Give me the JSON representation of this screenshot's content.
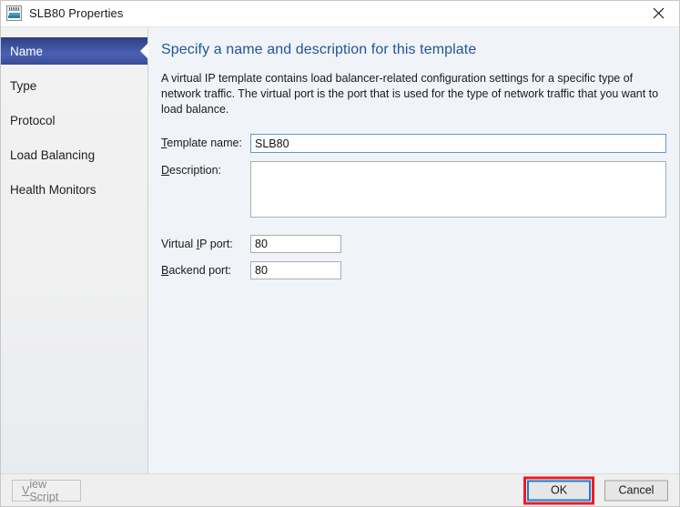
{
  "window": {
    "title": "SLB80 Properties",
    "icon": "template-window-icon",
    "close_label": "✕"
  },
  "sidebar": {
    "items": [
      {
        "label": "Name",
        "selected": true
      },
      {
        "label": "Type",
        "selected": false
      },
      {
        "label": "Protocol",
        "selected": false
      },
      {
        "label": "Load Balancing",
        "selected": false
      },
      {
        "label": "Health Monitors",
        "selected": false
      }
    ]
  },
  "content": {
    "heading": "Specify a name and description for this template",
    "description": "A virtual IP template contains load balancer-related configuration settings for a specific type of network traffic. The virtual port is the port that is used for the type of network traffic that you want to load balance.",
    "fields": {
      "template_name": {
        "label_prefix": "",
        "label_accel": "T",
        "label_suffix": "emplate name:",
        "value": "SLB80",
        "placeholder": ""
      },
      "description": {
        "label_prefix": "",
        "label_accel": "D",
        "label_suffix": "escription:",
        "value": "",
        "placeholder": ""
      },
      "virtual_ip_port": {
        "label_prefix": "Virtual ",
        "label_accel": "I",
        "label_suffix": "P port:",
        "value": "80",
        "placeholder": ""
      },
      "backend_port": {
        "label_prefix": "",
        "label_accel": "B",
        "label_suffix": "ackend port:",
        "value": "80",
        "placeholder": ""
      }
    }
  },
  "footer": {
    "view_script": {
      "accel": "V",
      "suffix": "iew Script",
      "disabled": true
    },
    "ok_label": "OK",
    "cancel_label": "Cancel"
  },
  "colors": {
    "heading_blue": "#21559b",
    "selected_nav_blue": "#3b4f9c",
    "annotation_red": "#ee1c25",
    "focus_blue": "#1a7ed1",
    "content_bg": "#f0f4f8",
    "footer_bg": "#efefef"
  }
}
